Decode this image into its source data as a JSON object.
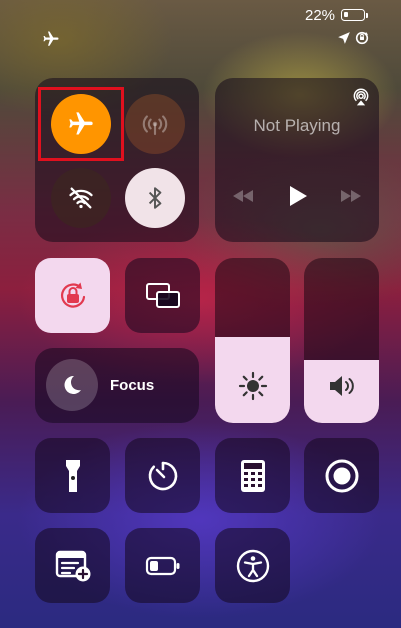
{
  "status_bar": {
    "battery_text": "22%",
    "battery_level": 0.22,
    "icons": [
      "airplane-mode-icon",
      "location-arrow-icon",
      "orientation-lock-icon"
    ]
  },
  "connectivity": {
    "airplane_mode": {
      "icon": "airplane-icon",
      "state": "on",
      "color": "#ff9500"
    },
    "cellular_data": {
      "icon": "cellular-antenna-icon",
      "state": "disabled"
    },
    "wifi": {
      "icon": "wifi-off-icon",
      "state": "off"
    },
    "bluetooth": {
      "icon": "bluetooth-icon",
      "state": "on"
    }
  },
  "now_playing": {
    "title": "Not Playing",
    "controls": [
      "rewind-icon",
      "play-icon",
      "fast-forward-icon"
    ],
    "airplay_icon": "airplay-audio-icon"
  },
  "controls": {
    "orientation_lock": {
      "icon": "orientation-lock-icon",
      "state": "on"
    },
    "screen_mirroring": {
      "icon": "screen-mirroring-icon"
    },
    "focus": {
      "label": "Focus",
      "icon": "moon-icon"
    }
  },
  "sliders": {
    "brightness": {
      "icon": "sun-icon",
      "level": 0.52
    },
    "volume": {
      "icon": "speaker-icon",
      "level": 0.38
    }
  },
  "shortcuts_row1": [
    "flashlight-icon",
    "timer-icon",
    "calculator-icon",
    "screen-record-icon"
  ],
  "shortcuts_row2": [
    "add-note-icon",
    "low-power-mode-icon",
    "accessibility-icon"
  ],
  "colors": {
    "accent_orange": "#ff9500",
    "tile_light": "#f3d8ee",
    "highlight_red": "#e0101e"
  }
}
